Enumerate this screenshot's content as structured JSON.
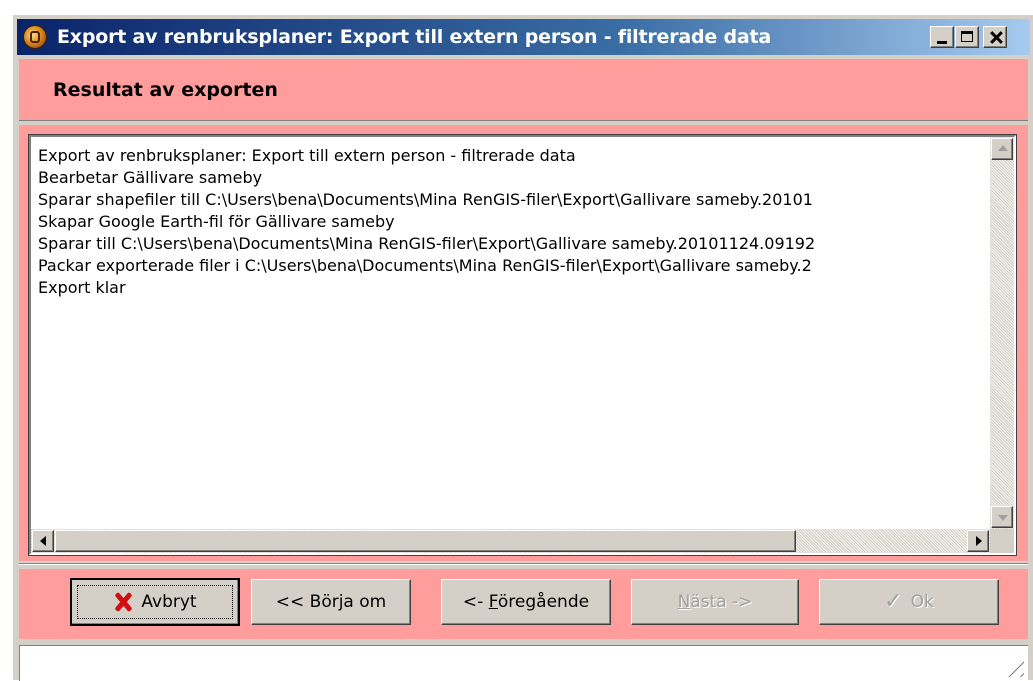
{
  "window": {
    "title": "Export av renbruksplaner: Export till extern person - filtrerade data"
  },
  "header": {
    "title": "Resultat av exporten"
  },
  "log": {
    "lines": [
      "Export av renbruksplaner: Export till extern person - filtrerade data",
      "Bearbetar Gällivare sameby",
      "Sparar shapefiler till C:\\Users\\bena\\Documents\\Mina RenGIS-filer\\Export\\Gallivare sameby.20101",
      "Skapar Google Earth-fil för Gällivare sameby",
      "Sparar till C:\\Users\\bena\\Documents\\Mina RenGIS-filer\\Export\\Gallivare sameby.20101124.09192",
      "Packar exporterade filer i C:\\Users\\bena\\Documents\\Mina RenGIS-filer\\Export\\Gallivare sameby.2",
      "Export klar"
    ]
  },
  "buttons": {
    "cancel": "Avbryt",
    "restart": "<< Börja om",
    "previous_prefix": "<- ",
    "previous_mnemonic": "F",
    "previous_rest": "öregående",
    "next_mnemonic": "N",
    "next_rest": "ästa ->",
    "ok": "Ok"
  },
  "colors": {
    "band": "#ff9c9c",
    "titlebar_start": "#0a246a",
    "titlebar_end": "#a6caf0",
    "cancel_icon": "#d01010"
  },
  "icons": {
    "app": "app-icon",
    "cancel": "x-icon",
    "ok": "check-icon"
  }
}
